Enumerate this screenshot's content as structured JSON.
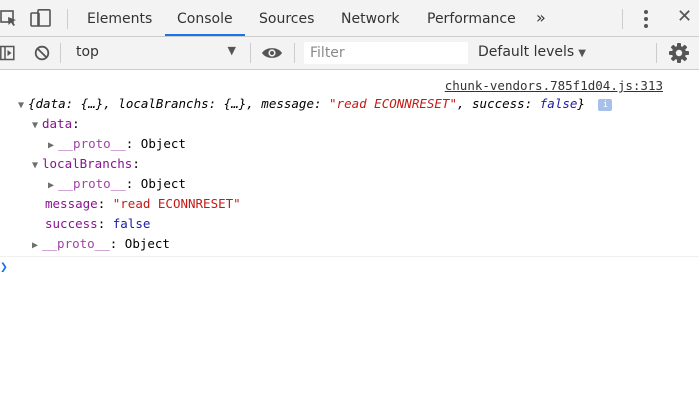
{
  "tabs": [
    {
      "label": "Elements"
    },
    {
      "label": "Console"
    },
    {
      "label": "Sources"
    },
    {
      "label": "Network"
    },
    {
      "label": "Performance"
    }
  ],
  "active_tab": "Console",
  "more_tabs_glyph": "»",
  "close_glyph": "✕",
  "toolbar": {
    "context": "top",
    "filter_placeholder": "Filter",
    "levels": "Default levels"
  },
  "console": {
    "source": "chunk-vendors.785f1d04.js:313",
    "summary": {
      "open": "{data: {…}, localBranchs: {…}, message: ",
      "message_value": "\"read ECONNRESET\"",
      "mid": ", success: ",
      "success_value": "false",
      "close": "}",
      "badge": "i"
    },
    "tree": {
      "data_key": "data",
      "localBranchs_key": "localBranchs",
      "message_key": "message",
      "message_value": "\"read ECONNRESET\"",
      "success_key": "success",
      "success_value": "false",
      "proto_key": "__proto__",
      "proto_value": "Object"
    },
    "prompt": "❯"
  }
}
